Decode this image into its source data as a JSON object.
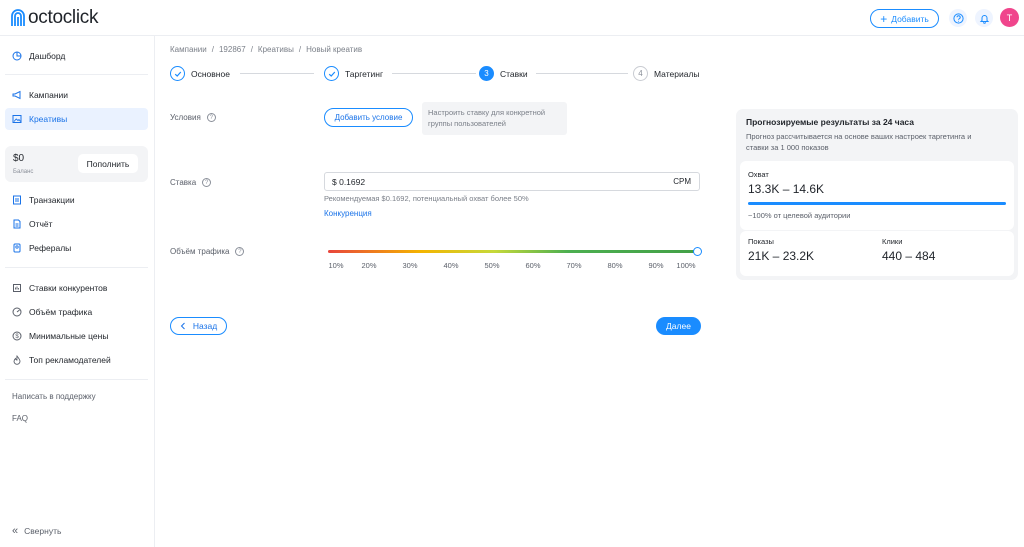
{
  "header": {
    "logo_text": "octoclick",
    "add_label": "Добавить",
    "avatar_letter": "T",
    "icons": [
      "help-icon",
      "bell-icon"
    ]
  },
  "sidebar": {
    "items": [
      {
        "label": "Дашборд",
        "icon": "dashboard-icon"
      },
      {
        "label": "Кампании",
        "icon": "megaphone-icon"
      },
      {
        "label": "Креативы",
        "icon": "image-icon",
        "active": true
      },
      {
        "label": "Транзакции",
        "icon": "transactions-icon"
      },
      {
        "label": "Отчёт",
        "icon": "report-icon"
      },
      {
        "label": "Рефералы",
        "icon": "referrals-icon"
      },
      {
        "label": "Ставки конкурентов",
        "icon": "competitor-bids-icon"
      },
      {
        "label": "Объём трафика",
        "icon": "traffic-icon"
      },
      {
        "label": "Минимальные цены",
        "icon": "dollar-icon"
      },
      {
        "label": "Топ рекламодателей",
        "icon": "fire-icon"
      }
    ],
    "balance": {
      "amount": "$0",
      "label": "Баланс",
      "topup": "Пополнить"
    },
    "support": "Написать в поддержку",
    "faq": "FAQ",
    "collapse": "Свернуть"
  },
  "breadcrumb": [
    "Кампании",
    "/",
    "192867",
    "/",
    "Креативы",
    "/",
    "Новый креатив"
  ],
  "steps": [
    {
      "num": "✓",
      "label": "Основное",
      "state": "done"
    },
    {
      "num": "✓",
      "label": "Таргетинг",
      "state": "done"
    },
    {
      "num": "3",
      "label": "Ставки",
      "state": "current"
    },
    {
      "num": "4",
      "label": "Материалы",
      "state": "future"
    }
  ],
  "conditions": {
    "label": "Условия",
    "button": "Добавить условие",
    "hint": "Настроить ставку для конкретной группы пользователей"
  },
  "bid": {
    "label": "Ставка",
    "value": "$ 0.1692",
    "unit": "CPM",
    "recommendation": "Рекомендуемая $0.1692, потенциальный охват более 50%",
    "link": "Конкуренция"
  },
  "traffic": {
    "label": "Объём трафика",
    "ticks": [
      "10%",
      "20%",
      "30%",
      "40%",
      "50%",
      "60%",
      "70%",
      "80%",
      "90%",
      "100%"
    ],
    "value_percent": 100
  },
  "nav": {
    "back": "Назад",
    "next": "Далее"
  },
  "forecast": {
    "title": "Прогнозируемые результаты за 24 часа",
    "description": "Прогноз рассчитывается на основе ваших настроек таргетинга и ставки за 1 000 показов",
    "reach_label": "Охват",
    "reach_value": "13.3K – 14.6K",
    "reach_note": "~100% от целевой аудитории",
    "impressions_label": "Показы",
    "impressions_value": "21K – 23.2K",
    "clicks_label": "Клики",
    "clicks_value": "440 – 484"
  },
  "colors": {
    "accent": "#1a8cff",
    "avatar": "#f0458c"
  }
}
